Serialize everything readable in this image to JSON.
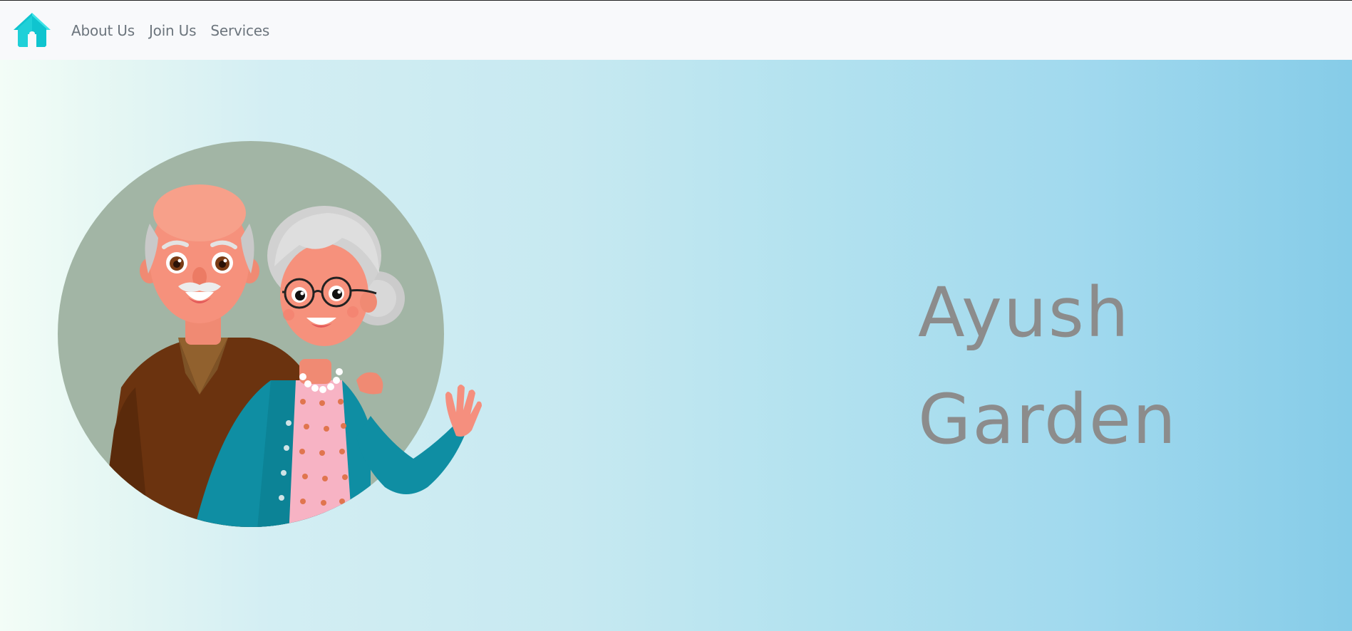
{
  "navbar": {
    "brand_icon": "house-icon",
    "brand_colors": {
      "light": "#3ee4e8",
      "dark": "#0fc4cf"
    },
    "links": [
      {
        "label": "About Us"
      },
      {
        "label": "Join Us"
      },
      {
        "label": "Services"
      }
    ]
  },
  "hero": {
    "title_line1": "Ayush",
    "title_line2": "Garden",
    "illustration": "elderly-couple-illustration",
    "colors": {
      "gradient_start": "#f3fdf7",
      "gradient_end": "#86cce8",
      "title_color": "#8c8c8c",
      "circle_bg": "#a2b5a5"
    }
  }
}
